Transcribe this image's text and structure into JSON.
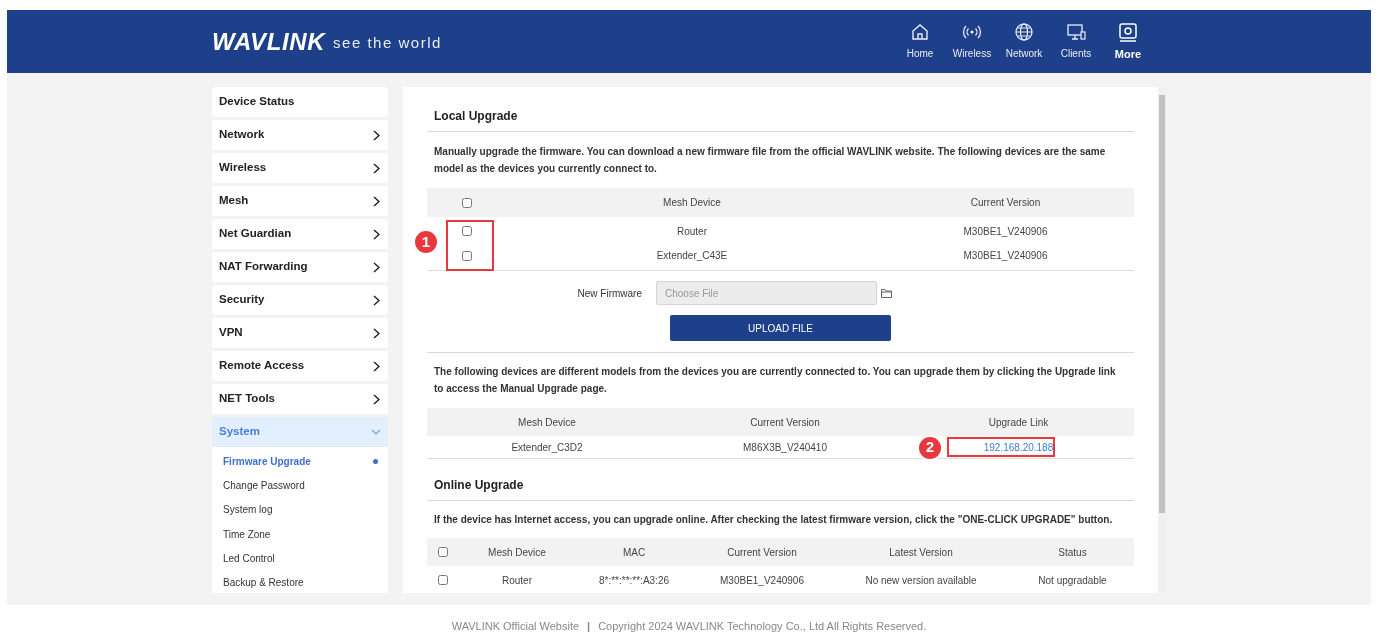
{
  "header": {
    "logo": "WAVLINK",
    "tagline": "see the world",
    "nav": [
      {
        "label": "Home",
        "selected": false
      },
      {
        "label": "Wireless",
        "selected": false
      },
      {
        "label": "Network",
        "selected": false
      },
      {
        "label": "Clients",
        "selected": false
      },
      {
        "label": "More",
        "selected": true
      }
    ]
  },
  "sidebar": {
    "items": [
      {
        "label": "Device Status",
        "has_arrow": false,
        "expanded": false
      },
      {
        "label": "Network",
        "has_arrow": true,
        "expanded": false
      },
      {
        "label": "Wireless",
        "has_arrow": true,
        "expanded": false
      },
      {
        "label": "Mesh",
        "has_arrow": true,
        "expanded": false
      },
      {
        "label": "Net Guardian",
        "has_arrow": true,
        "expanded": false
      },
      {
        "label": "NAT Forwarding",
        "has_arrow": true,
        "expanded": false
      },
      {
        "label": "Security",
        "has_arrow": true,
        "expanded": false
      },
      {
        "label": "VPN",
        "has_arrow": true,
        "expanded": false
      },
      {
        "label": "Remote Access",
        "has_arrow": true,
        "expanded": false
      },
      {
        "label": "NET Tools",
        "has_arrow": true,
        "expanded": false
      },
      {
        "label": "System",
        "has_arrow": true,
        "expanded": true,
        "children": [
          {
            "label": "Firmware Upgrade",
            "selected": true
          },
          {
            "label": "Change Password",
            "selected": false
          },
          {
            "label": "System log",
            "selected": false
          },
          {
            "label": "Time Zone",
            "selected": false
          },
          {
            "label": "Led Control",
            "selected": false
          },
          {
            "label": "Backup & Restore",
            "selected": false
          }
        ]
      }
    ]
  },
  "local_upgrade": {
    "title": "Local Upgrade",
    "description": "Manually upgrade the firmware. You can download a new firmware file from the official WAVLINK website. The following devices are the same model as the devices you currently connect to.",
    "table": {
      "header_checked": false,
      "columns": [
        "Mesh Device",
        "Current Version"
      ],
      "rows": [
        {
          "checked": false,
          "cells": [
            "Router",
            "M30BE1_V240906"
          ]
        },
        {
          "checked": false,
          "cells": [
            "Extender_C43E",
            "M30BE1_V240906"
          ]
        }
      ]
    },
    "annotation": "1",
    "file_label": "New Firmware",
    "file_placeholder": "Choose File",
    "upload_button": "UPLOAD FILE",
    "other_description": "The following devices are different models from the devices you are currently connected to. You can upgrade them by clicking the Upgrade link to access the Manual Upgrade page.",
    "other_table": {
      "columns": [
        "Mesh Device",
        "Current Version",
        "Upgrade Link"
      ],
      "rows": [
        {
          "cells": [
            "Extender_C3D2",
            "M86X3B_V240410"
          ],
          "link": "192.168.20.188",
          "annotation": "2"
        }
      ]
    }
  },
  "online_upgrade": {
    "title": "Online Upgrade",
    "description": "If the device has Internet access, you can upgrade online. After checking the latest firmware version, click the \"ONE-CLICK UPGRADE\" button.",
    "table": {
      "header_checked": false,
      "columns": [
        "Mesh Device",
        "MAC",
        "Current Version",
        "Latest Version",
        "Status"
      ],
      "rows": [
        {
          "checked": false,
          "cells": [
            "Router",
            "8*:**:**:**:A3:26",
            "M30BE1_V240906",
            "No new version available",
            "Not upgradable"
          ]
        }
      ]
    }
  },
  "footer": {
    "link": "WAVLINK Official Website",
    "separator": "|",
    "copyright": "Copyright 2024 WAVLINK Technology Co., Ltd All Rights Reserved."
  }
}
